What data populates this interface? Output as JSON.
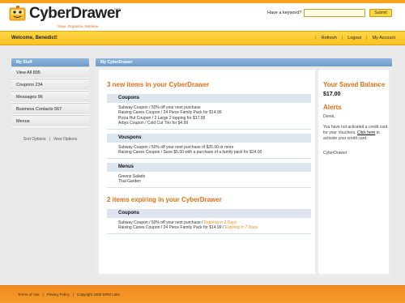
{
  "header": {
    "logo_text": "CyberDrawer",
    "logo_beta": "beta",
    "tagline": "Save. Organize. Retrieve.",
    "search_label": "Have a keyword?",
    "search_value": "",
    "submit_label": "Submit"
  },
  "navbar": {
    "welcome": "Welcome, Benedict!",
    "links": [
      "Refresh",
      "Logout",
      "My Account"
    ]
  },
  "sidebar": {
    "title": "My Stuff",
    "items": [
      {
        "label": "View All  895"
      },
      {
        "label": "Coupons 234"
      },
      {
        "label": "Messages 96"
      },
      {
        "label": "Business Contacts 567"
      },
      {
        "label": "Menus"
      }
    ],
    "sort_options": "Sort Options",
    "view_options": "View Options"
  },
  "main": {
    "title": "My CyberDrawer",
    "new_items_title": "3 new items in your CyberDrawer",
    "categories_new": [
      {
        "name": "Coupons",
        "items": [
          "Subway Coupon / 50% off your next purchase",
          "Raising Canes Coupon / 24 Piece Family Pack for $14.99",
          "Pizza Hut Coupon /  2 Large 2 topping for $17.99",
          "Arbys Coupon / Cold Cut Trio for $4.99"
        ]
      },
      {
        "name": "Vouspons",
        "items": [
          "Subway Coupon / 50% off your next purchase of $25.00 or more",
          "Raising Canes Coupon / Save $5.00 with a purchase of a family pack for $24.00"
        ]
      },
      {
        "name": "Menus",
        "items": [
          "Greenz Salads",
          "Thai Garden"
        ]
      }
    ],
    "expiring_title": "2 items expiring in your CyberDrawer",
    "categories_expiring": [
      {
        "name": "Coupons",
        "items": [
          {
            "text": "Subway Coupon / 50% off your next purchase / ",
            "expiry": "Expiring in 3 Days"
          },
          {
            "text": "Raising Canes Coupon / 24 Piece Family Pack for $14.99 / ",
            "expiry": "Expiring in 7 Days"
          }
        ]
      }
    ]
  },
  "right": {
    "balance_title": "Your Saved Balance",
    "balance_amount": "$17.00",
    "alerts_title": "Alerts",
    "greeting": "Derek,",
    "alert_text_pre": "You have not activated a credit card for your Vouchers. ",
    "alert_link": "Click here",
    "alert_text_post": " to activate your credit card.",
    "signature": "CyberDrawer"
  },
  "footer": {
    "terms": "Terms of Use",
    "privacy": "Privacy Policy",
    "copyright": "Copyright 2008 DRM Labs"
  },
  "colors": {
    "brand_orange": "#e96f12",
    "nav_yellow": "#f9c21f",
    "panel_blue": "#6d9ccb",
    "footer_orange": "#f28a1f"
  },
  "icons": [
    "drawer-logo-icon"
  ]
}
